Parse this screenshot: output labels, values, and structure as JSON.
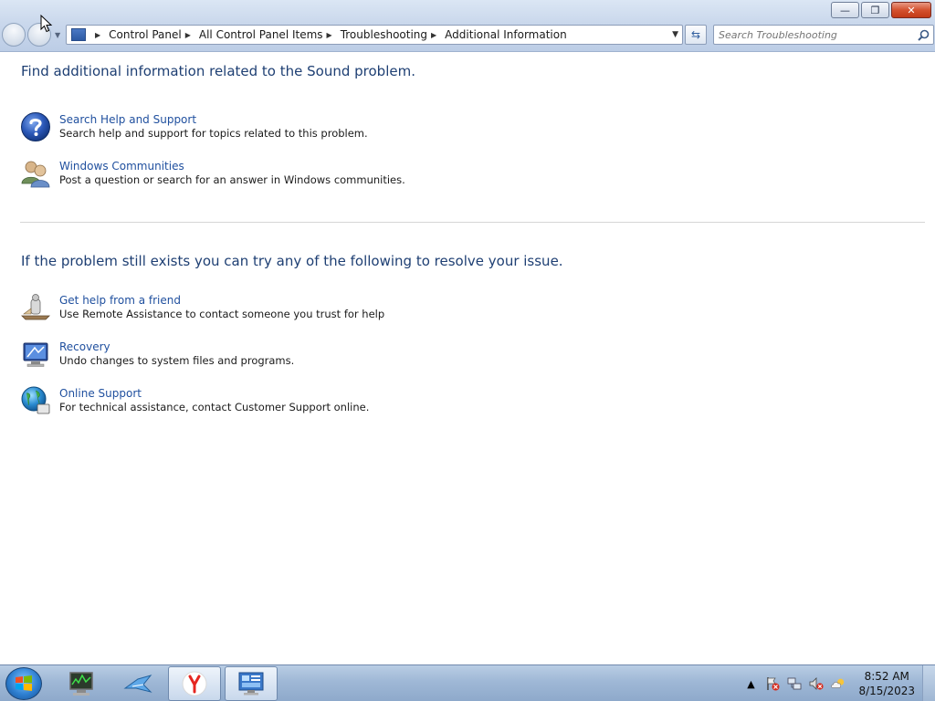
{
  "window": {
    "controls": {
      "minimize": "—",
      "restore": "❐",
      "close": "✕"
    }
  },
  "address_bar": {
    "breadcrumbs": [
      "Control Panel",
      "All Control Panel Items",
      "Troubleshooting",
      "Additional Information"
    ]
  },
  "search": {
    "placeholder": "Search Troubleshooting"
  },
  "section1": {
    "heading": "Find additional information related to the Sound problem.",
    "items": [
      {
        "title": "Search Help and Support",
        "description": "Search help and support for topics related to this problem.",
        "icon": "help-icon"
      },
      {
        "title": "Windows Communities",
        "description": "Post a question or search for an answer in Windows communities.",
        "icon": "communities-icon"
      }
    ]
  },
  "section2": {
    "heading": "If the problem still exists you can try any of the following to resolve your issue.",
    "items": [
      {
        "title": "Get help from a friend",
        "description": "Use Remote Assistance to contact someone you trust for help",
        "icon": "remote-assistance-icon"
      },
      {
        "title": "Recovery",
        "description": "Undo changes to system files and programs.",
        "icon": "recovery-icon"
      },
      {
        "title": "Online Support",
        "description": "For technical assistance, contact Customer Support online.",
        "icon": "online-support-icon"
      }
    ]
  },
  "taskbar": {
    "time": "8:52 AM",
    "date": "8/15/2023",
    "apps": [
      "task-manager-icon",
      "network-app-icon",
      "yandex-browser-icon",
      "control-panel-icon"
    ]
  },
  "colors": {
    "heading": "#1e3f73",
    "link": "#1f4f9e",
    "close_button": "#c23a16"
  }
}
